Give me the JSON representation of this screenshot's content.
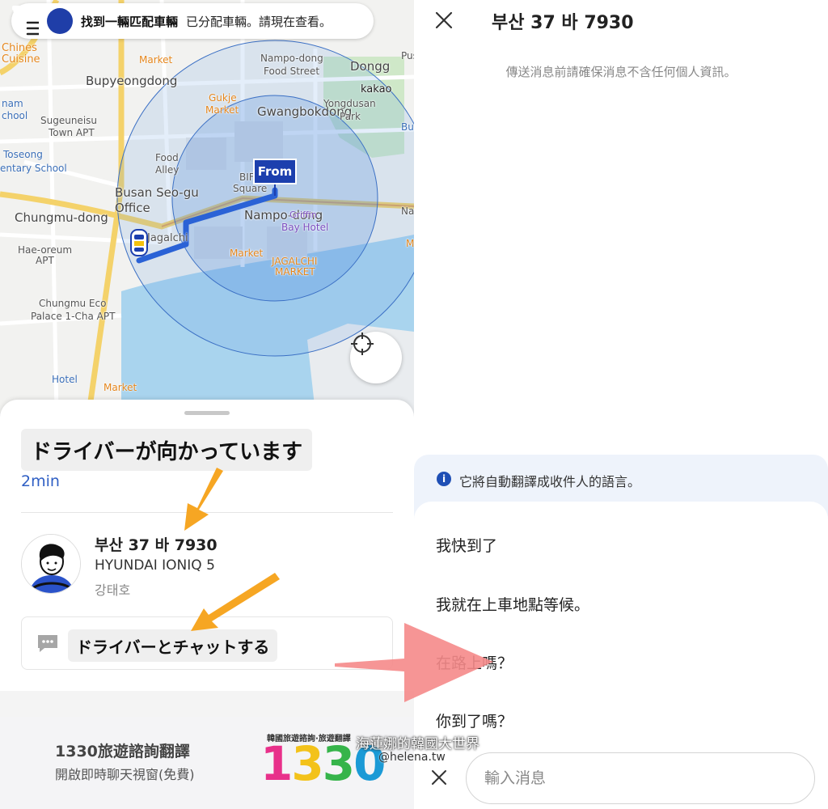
{
  "notification": {
    "title": "找到一輛匹配車輛",
    "text": "已分配車輛。請現在查看。"
  },
  "map": {
    "labels": {
      "chinese_cuisine_1": "Chines",
      "chinese_cuisine_2": "Cuisine",
      "market_top": "Market",
      "bupyeongdong": "Bupyeongdong",
      "nampo_food_1": "Nampo-dong",
      "nampo_food_2": "Food Street",
      "dongg": "Dongg",
      "pus": "Pus",
      "kakao": "kakao",
      "gukje_1": "Gukje",
      "gukje_2": "Market",
      "gwangbokdong": "Gwangbokdong",
      "yongdusan_1": "Yongdusan",
      "yongdusan_2": "Park",
      "nam_school_1": "nam",
      "nam_school_2": "chool",
      "sugeuneisu_1": "Sugeuneisu",
      "sugeuneisu_2": "Town APT",
      "bu": "Bu",
      "toseong_1": "Toseong",
      "toseong_2": "entary School",
      "food_alley_1": "Food",
      "food_alley_2": "Alley",
      "biff_1": "BIF",
      "biff_2": "Square",
      "busan_seogu_1": "Busan Seo-gu",
      "busan_seogu_2": "Office",
      "na": "Na",
      "chungmudong": "Chungmu-dong",
      "nampodong": "Nampo-dong",
      "griffin_1": "Griffin",
      "griffin_2": "Bay Hotel",
      "jagalchi": "Jagalchi",
      "hae_oreum_1": "Hae-oreum",
      "hae_oreum_2": "APT",
      "market_mid": "Market",
      "jagalchi_market_1": "JAGALCHI",
      "jagalchi_market_2": "MARKET",
      "m": "M",
      "chungmu_eco_1": "Chungmu Eco",
      "chungmu_eco_2": "Palace 1-Cha APT",
      "hotel": "Hotel",
      "market_bottom": "Market"
    },
    "pickup_flag": "From"
  },
  "sheet": {
    "status": "ドライバーが向かっています",
    "eta": "2min",
    "plate": "부산 37 바 7930",
    "car_model": "HYUNDAI IONIQ 5",
    "driver_name": "강태호",
    "chat_label": "ドライバーとチャットする"
  },
  "banner": {
    "title": "1330旅遊諮詢翻譯",
    "subtitle": "開啟即時聊天視窗(免費)",
    "logo_caption": "韓國旅遊諮詢·旅遊翻譯",
    "logo_digits": [
      "1",
      "3",
      "3",
      "0"
    ]
  },
  "chat": {
    "title": "부산 37 바 7930",
    "privacy_notice": "傳送消息前請確保消息不含任何個人資訊。",
    "translate_notice": "它將自動翻譯成收件人的語言。",
    "info_icon_glyph": "i",
    "quick_replies": [
      "我快到了",
      "我就在上車地點等候。",
      "在路上嗎？",
      "你到了嗎？"
    ],
    "input_placeholder": "輸入消息"
  },
  "watermark": {
    "text": "海蓮娜的韓國大世界",
    "handle": "@helena.tw"
  },
  "colors": {
    "accent_blue": "#2f5fc4",
    "brand_navy": "#1f3ea8",
    "arrow_orange": "#f6a623",
    "arrow_pink": "#f58a8a",
    "logo_colors": [
      "#e8308a",
      "#f3c21a",
      "#36b44a",
      "#1b9ad6"
    ]
  },
  "icons": {
    "menu": "menu-icon",
    "car": "car-icon",
    "locate": "crosshair-icon",
    "chat": "chat-bubble-icon",
    "close": "close-icon",
    "info": "info-icon"
  }
}
